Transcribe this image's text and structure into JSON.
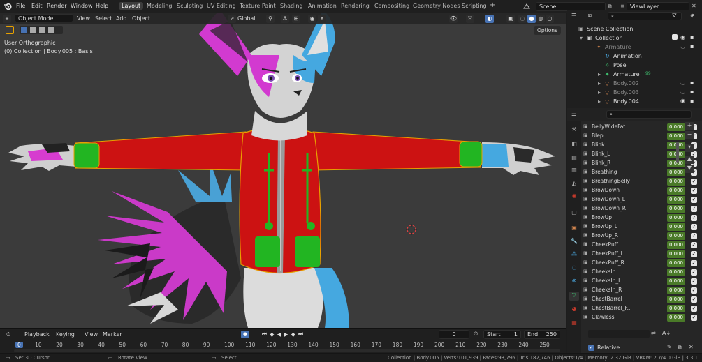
{
  "menus": [
    "File",
    "Edit",
    "Render",
    "Window",
    "Help"
  ],
  "workspaces": [
    "Layout",
    "Modeling",
    "Sculpting",
    "UV Editing",
    "Texture Paint",
    "Shading",
    "Animation",
    "Rendering",
    "Compositing",
    "Geometry Nodes",
    "Scripting"
  ],
  "add_tab": "+",
  "scene": "Scene",
  "view_layer": "ViewLayer",
  "viewport": {
    "mode": "Object Mode",
    "menus": [
      "View",
      "Select",
      "Add",
      "Object"
    ],
    "orientation": "Global",
    "view_name": "User Orthographic",
    "context": "(0) Collection | Body.005 : Basis",
    "options": "Options"
  },
  "outliner": {
    "items": [
      "Scene Collection",
      "Collection",
      "Armature",
      "Animation",
      "Pose",
      "Armature",
      "Body.002",
      "Body.003",
      "Body.004"
    ],
    "armature_count": "99"
  },
  "shape_keys": [
    "BellyWideFat",
    "Blep",
    "Blink",
    "Blink_L",
    "Blink_R",
    "Breathing",
    "BreathingBelly",
    "BrowDown",
    "BrowDown_L",
    "BrowDown_R",
    "BrowUp",
    "BrowUp_L",
    "BrowUp_R",
    "CheekPuff",
    "CheekPuff_L",
    "CheekPuff_R",
    "CheeksIn",
    "CheeksIn_L",
    "CheeksIn_R",
    "ChestBarrel",
    "ChestBarrel_F...",
    "Clawless"
  ],
  "shape_value": "0.000",
  "relative_label": "Relative",
  "timeline": {
    "menus": [
      "Playback",
      "Keying",
      "View",
      "Marker"
    ],
    "current_frame": "0",
    "start_label": "Start",
    "start": "1",
    "end_label": "End",
    "end": "250",
    "ticks": [
      "0",
      "10",
      "20",
      "30",
      "40",
      "50",
      "60",
      "70",
      "80",
      "90",
      "100",
      "110",
      "120",
      "130",
      "140",
      "150",
      "160",
      "170",
      "180",
      "190",
      "200",
      "210",
      "220",
      "230",
      "240",
      "250"
    ]
  },
  "status": {
    "left": "Set 3D Cursor",
    "mid": "Rotate View",
    "right": "Select",
    "stats": "Collection | Body.005 | Verts:101,939 | Faces:93,796 | Tris:182,746 | Objects:1/4 | Memory: 2.32 GiB | VRAM: 2.7/4.0 GiB | 3.3.1"
  },
  "colors": {
    "accent": "#4772b3",
    "value_green": "#4a7a28",
    "jacket": "#cc1212",
    "pocket": "#22b522",
    "selection": "#e8a100"
  }
}
